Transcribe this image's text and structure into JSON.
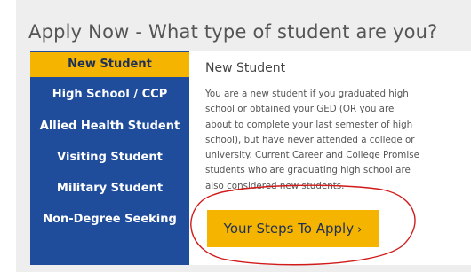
{
  "heading": "Apply Now - What type of student are you?",
  "tabs": [
    {
      "label": "New Student",
      "active": true
    },
    {
      "label": "High School / CCP",
      "active": false
    },
    {
      "label": "Allied Health Student",
      "active": false
    },
    {
      "label": "Visiting Student",
      "active": false
    },
    {
      "label": "Military Student",
      "active": false
    },
    {
      "label": "Non-Degree Seeking",
      "active": false
    }
  ],
  "content": {
    "title": "New Student",
    "body_lines": [
      "You are a new student if you graduated high",
      "school or obtained your GED (OR you are",
      "about to complete your last semester of high",
      "school), but have never attended a college or",
      "university. Current Career and College Promise",
      "students who are graduating high school are",
      "also considered new students."
    ],
    "cta_label": "Your Steps To Apply",
    "cta_chevron": "›"
  },
  "colors": {
    "sidebar": "#1f4d9b",
    "accent": "#f5b400",
    "annotation": "#d11a1a"
  },
  "icons": {
    "cta": "chevron-right-icon"
  }
}
